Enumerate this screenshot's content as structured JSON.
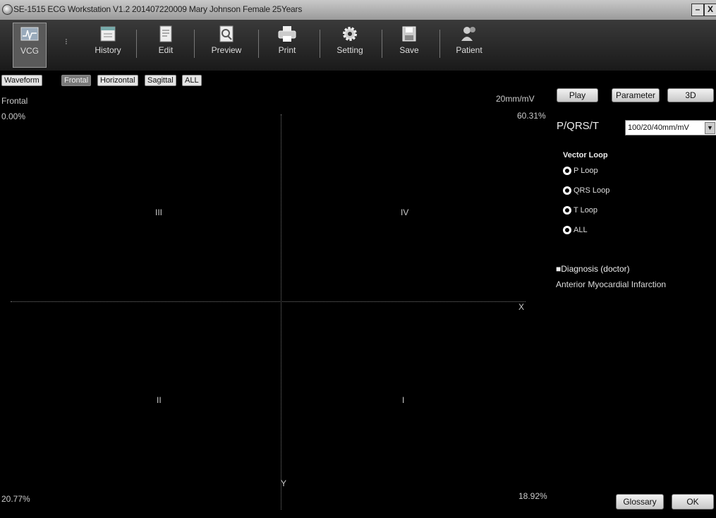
{
  "window": {
    "title": "SE-1515 ECG Workstation V1.2   201407220009  Mary Johnson  Female 25Years",
    "minimize_label": "–",
    "close_label": "X"
  },
  "toolbar": {
    "vcg_label": "VCG",
    "history_label": "History",
    "edit_label": "Edit",
    "preview_label": "Preview",
    "print_label": "Print",
    "setting_label": "Setting",
    "save_label": "Save",
    "patient_label": "Patient"
  },
  "tabs": [
    {
      "label": "Waveform",
      "active": false
    },
    {
      "label": "Frontal",
      "active": true
    },
    {
      "label": "Horizontal",
      "active": false
    },
    {
      "label": "Sagittal",
      "active": false
    },
    {
      "label": "ALL",
      "active": false
    }
  ],
  "plot": {
    "view_name": "Frontal",
    "sensitivity": "20mm/mV",
    "top_left_pct": "0.00%",
    "top_right_pct": "60.31%",
    "bottom_left_pct": "20.77%",
    "bottom_right_pct": "18.92%",
    "quadrants": {
      "top_left": "III",
      "top_right": "IV",
      "bottom_left": "II",
      "bottom_right": "I"
    },
    "x_axis": "X",
    "y_axis": "Y"
  },
  "panel": {
    "play_label": "Play",
    "parameter_label": "Parameter",
    "three_d_label": "3D",
    "pqrst_label": "P/QRS/T",
    "scale_selected": "100/20/40mm/mV",
    "vector_loop_title": "Vector Loop",
    "loops": [
      "P Loop",
      "QRS Loop",
      "T Loop",
      "ALL"
    ],
    "diagnosis_title": "■Diagnosis (doctor)",
    "diagnosis_text": "Anterior Myocardial Infarction",
    "glossary_label": "Glossary",
    "ok_label": "OK"
  }
}
